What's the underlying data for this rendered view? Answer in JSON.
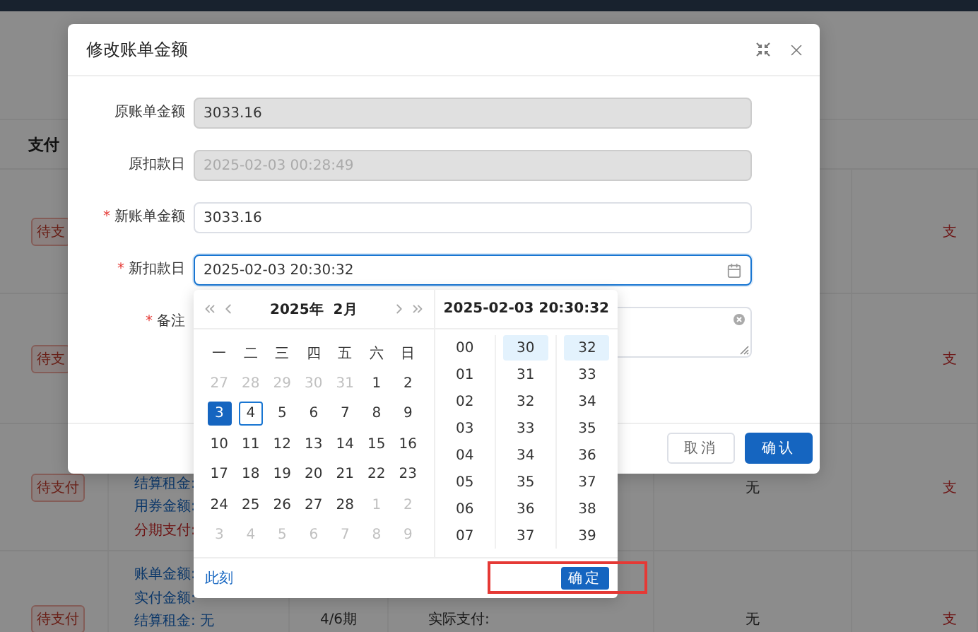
{
  "background": {
    "header": "支付",
    "rows": [
      {
        "status": "待支",
        "lines": [],
        "period": "",
        "detail": "",
        "result": "",
        "action": "支"
      },
      {
        "status": "待支",
        "lines": [],
        "period": "",
        "detail": "",
        "result": "",
        "action": "支"
      },
      {
        "status": "待支付",
        "lines": [
          {
            "text": "结算租金:",
            "kind": "info"
          },
          {
            "text": "用券金额:",
            "kind": "info"
          },
          {
            "text": "分期支付:",
            "kind": "alert"
          }
        ],
        "period": "",
        "detail": "",
        "result": "无",
        "action": "支"
      },
      {
        "status": "待支付",
        "lines": [
          {
            "text": "账单金额:",
            "kind": "info"
          },
          {
            "text": "实付金额:",
            "kind": "info"
          },
          {
            "text": "结算租金: 无",
            "kind": "info"
          }
        ],
        "period": "4/6期",
        "detail": "实际支付:",
        "result": "无",
        "action": "支"
      }
    ]
  },
  "dialog": {
    "title": "修改账单金额",
    "fields": [
      {
        "label": "原账单金额",
        "kind": "text",
        "value": "3033.16",
        "disabled": true,
        "focused": false
      },
      {
        "label": "原扣款日",
        "kind": "text",
        "placeholder": "2025-02-03 00:28:49",
        "disabled": true,
        "focused": false
      },
      {
        "label": "新账单金额",
        "required_mark": "*",
        "kind": "text",
        "value": "3033.16",
        "disabled": false,
        "focused": false
      },
      {
        "label": "新扣款日",
        "required_mark": "*",
        "kind": "date",
        "value": "2025-02-03 20:30:32",
        "disabled": false,
        "focused": true
      },
      {
        "label": "备注",
        "required_mark": "*",
        "kind": "textarea",
        "disabled": false,
        "focused": false
      }
    ],
    "buttons": [
      {
        "label": "取消",
        "kind": "default"
      },
      {
        "label": "确认",
        "kind": "primary"
      }
    ]
  },
  "date_picker": {
    "month_title": "2025年  2月",
    "time_title": "2025-02-03 20:30:32",
    "weekdays": [
      "一",
      "二",
      "三",
      "四",
      "五",
      "六",
      "日"
    ],
    "days": [
      {
        "day": "27",
        "muted": true,
        "selected": false,
        "today": false
      },
      {
        "day": "28",
        "muted": true,
        "selected": false,
        "today": false
      },
      {
        "day": "29",
        "muted": true,
        "selected": false,
        "today": false
      },
      {
        "day": "30",
        "muted": true,
        "selected": false,
        "today": false
      },
      {
        "day": "31",
        "muted": true,
        "selected": false,
        "today": false
      },
      {
        "day": "1",
        "muted": false,
        "selected": false,
        "today": false
      },
      {
        "day": "2",
        "muted": false,
        "selected": false,
        "today": false
      },
      {
        "day": "3",
        "muted": false,
        "selected": true,
        "today": false
      },
      {
        "day": "4",
        "muted": false,
        "selected": false,
        "today": true
      },
      {
        "day": "5",
        "muted": false,
        "selected": false,
        "today": false
      },
      {
        "day": "6",
        "muted": false,
        "selected": false,
        "today": false
      },
      {
        "day": "7",
        "muted": false,
        "selected": false,
        "today": false
      },
      {
        "day": "8",
        "muted": false,
        "selected": false,
        "today": false
      },
      {
        "day": "9",
        "muted": false,
        "selected": false,
        "today": false
      },
      {
        "day": "10",
        "muted": false,
        "selected": false,
        "today": false
      },
      {
        "day": "11",
        "muted": false,
        "selected": false,
        "today": false
      },
      {
        "day": "12",
        "muted": false,
        "selected": false,
        "today": false
      },
      {
        "day": "13",
        "muted": false,
        "selected": false,
        "today": false
      },
      {
        "day": "14",
        "muted": false,
        "selected": false,
        "today": false
      },
      {
        "day": "15",
        "muted": false,
        "selected": false,
        "today": false
      },
      {
        "day": "16",
        "muted": false,
        "selected": false,
        "today": false
      },
      {
        "day": "17",
        "muted": false,
        "selected": false,
        "today": false
      },
      {
        "day": "18",
        "muted": false,
        "selected": false,
        "today": false
      },
      {
        "day": "19",
        "muted": false,
        "selected": false,
        "today": false
      },
      {
        "day": "20",
        "muted": false,
        "selected": false,
        "today": false
      },
      {
        "day": "21",
        "muted": false,
        "selected": false,
        "today": false
      },
      {
        "day": "22",
        "muted": false,
        "selected": false,
        "today": false
      },
      {
        "day": "23",
        "muted": false,
        "selected": false,
        "today": false
      },
      {
        "day": "24",
        "muted": false,
        "selected": false,
        "today": false
      },
      {
        "day": "25",
        "muted": false,
        "selected": false,
        "today": false
      },
      {
        "day": "26",
        "muted": false,
        "selected": false,
        "today": false
      },
      {
        "day": "27",
        "muted": false,
        "selected": false,
        "today": false
      },
      {
        "day": "28",
        "muted": false,
        "selected": false,
        "today": false
      },
      {
        "day": "1",
        "muted": true,
        "selected": false,
        "today": false
      },
      {
        "day": "2",
        "muted": true,
        "selected": false,
        "today": false
      },
      {
        "day": "3",
        "muted": true,
        "selected": false,
        "today": false
      },
      {
        "day": "4",
        "muted": true,
        "selected": false,
        "today": false
      },
      {
        "day": "5",
        "muted": true,
        "selected": false,
        "today": false
      },
      {
        "day": "6",
        "muted": true,
        "selected": false,
        "today": false
      },
      {
        "day": "7",
        "muted": true,
        "selected": false,
        "today": false
      },
      {
        "day": "8",
        "muted": true,
        "selected": false,
        "today": false
      },
      {
        "day": "9",
        "muted": true,
        "selected": false,
        "today": false
      }
    ],
    "time_columns": [
      [
        {
          "text": "00",
          "selected": false
        },
        {
          "text": "01",
          "selected": false
        },
        {
          "text": "02",
          "selected": false
        },
        {
          "text": "03",
          "selected": false
        },
        {
          "text": "04",
          "selected": false
        },
        {
          "text": "05",
          "selected": false
        },
        {
          "text": "06",
          "selected": false
        },
        {
          "text": "07",
          "selected": false
        }
      ],
      [
        {
          "text": "30",
          "selected": true
        },
        {
          "text": "31",
          "selected": false
        },
        {
          "text": "32",
          "selected": false
        },
        {
          "text": "33",
          "selected": false
        },
        {
          "text": "34",
          "selected": false
        },
        {
          "text": "35",
          "selected": false
        },
        {
          "text": "36",
          "selected": false
        },
        {
          "text": "37",
          "selected": false
        }
      ],
      [
        {
          "text": "32",
          "selected": true
        },
        {
          "text": "33",
          "selected": false
        },
        {
          "text": "34",
          "selected": false
        },
        {
          "text": "35",
          "selected": false
        },
        {
          "text": "36",
          "selected": false
        },
        {
          "text": "37",
          "selected": false
        },
        {
          "text": "38",
          "selected": false
        },
        {
          "text": "39",
          "selected": false
        }
      ]
    ],
    "now_link": "此刻",
    "ok_button": {
      "label": "确定",
      "highlighted": true
    }
  }
}
